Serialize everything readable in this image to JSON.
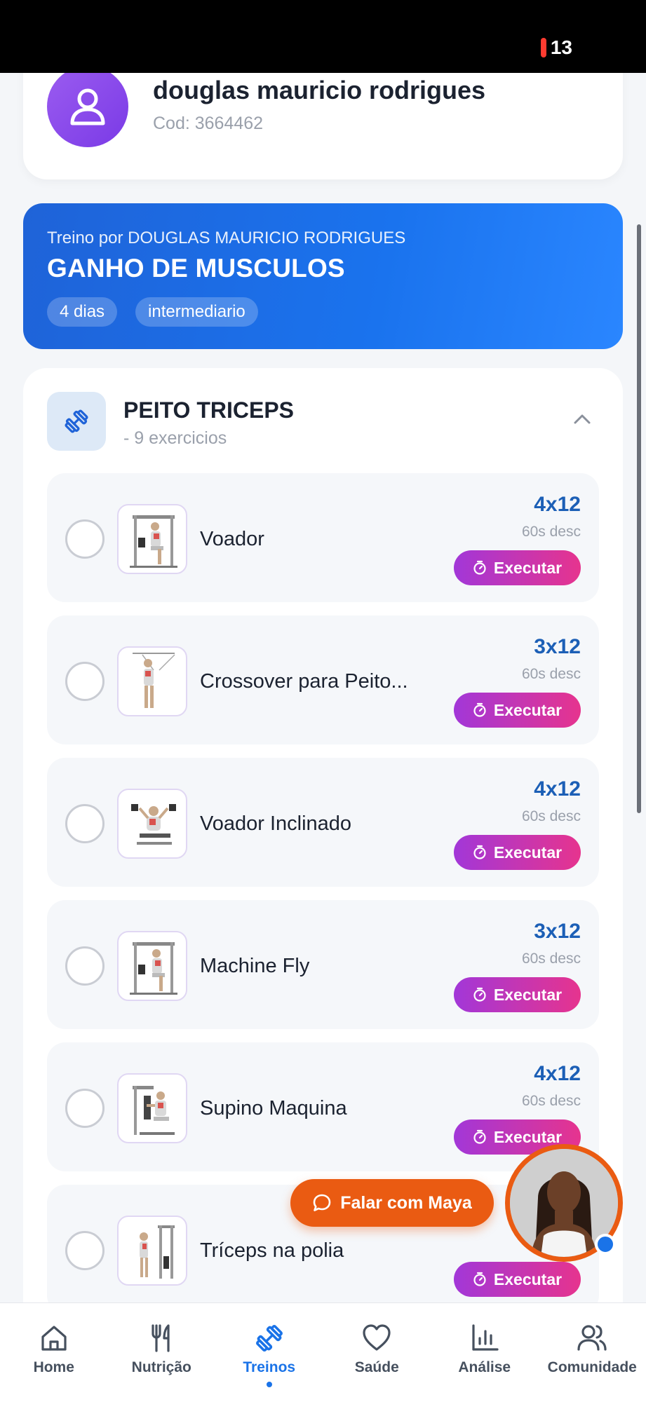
{
  "status_bar": {
    "battery_level": "13",
    "battery_color": "#ff3b30"
  },
  "profile": {
    "name": "douglas mauricio rodrigues",
    "code": "Cod: 3664462",
    "avatar_icon": "user-icon"
  },
  "plan": {
    "author": "Treino por DOUGLAS MAURICIO RODRIGUES",
    "title": "GANHO DE MUSCULOS",
    "tags": [
      "4 dias",
      "intermediario"
    ]
  },
  "group": {
    "title": "PEITO TRICEPS",
    "subtitle": "- 9 exercicios",
    "icon": "dumbbell-icon",
    "exercises": [
      {
        "name": "Voador",
        "sets": "4x12",
        "rest": "60s desc",
        "action": "Executar"
      },
      {
        "name": "Crossover para Peito...",
        "sets": "3x12",
        "rest": "60s desc",
        "action": "Executar"
      },
      {
        "name": "Voador Inclinado",
        "sets": "4x12",
        "rest": "60s desc",
        "action": "Executar"
      },
      {
        "name": "Machine Fly",
        "sets": "3x12",
        "rest": "60s desc",
        "action": "Executar"
      },
      {
        "name": "Supino Maquina",
        "sets": "4x12",
        "rest": "60s desc",
        "action": "Executar"
      },
      {
        "name": "Tríceps na polia",
        "sets": "",
        "rest": "",
        "action": "Executar"
      }
    ]
  },
  "assistant": {
    "button_label": "Falar com Maya",
    "accent": "#ea5b12"
  },
  "nav": {
    "items": [
      {
        "label": "Home",
        "icon": "home-icon"
      },
      {
        "label": "Nutrição",
        "icon": "fork-knife-icon"
      },
      {
        "label": "Treinos",
        "icon": "dumbbell-icon",
        "active": true
      },
      {
        "label": "Saúde",
        "icon": "heart-icon"
      },
      {
        "label": "Análise",
        "icon": "bar-chart-icon"
      },
      {
        "label": "Comunidade",
        "icon": "users-icon"
      }
    ]
  },
  "colors": {
    "primary": "#1a73e8",
    "execute_gradient": [
      "#a237d8",
      "#e6348e"
    ]
  }
}
